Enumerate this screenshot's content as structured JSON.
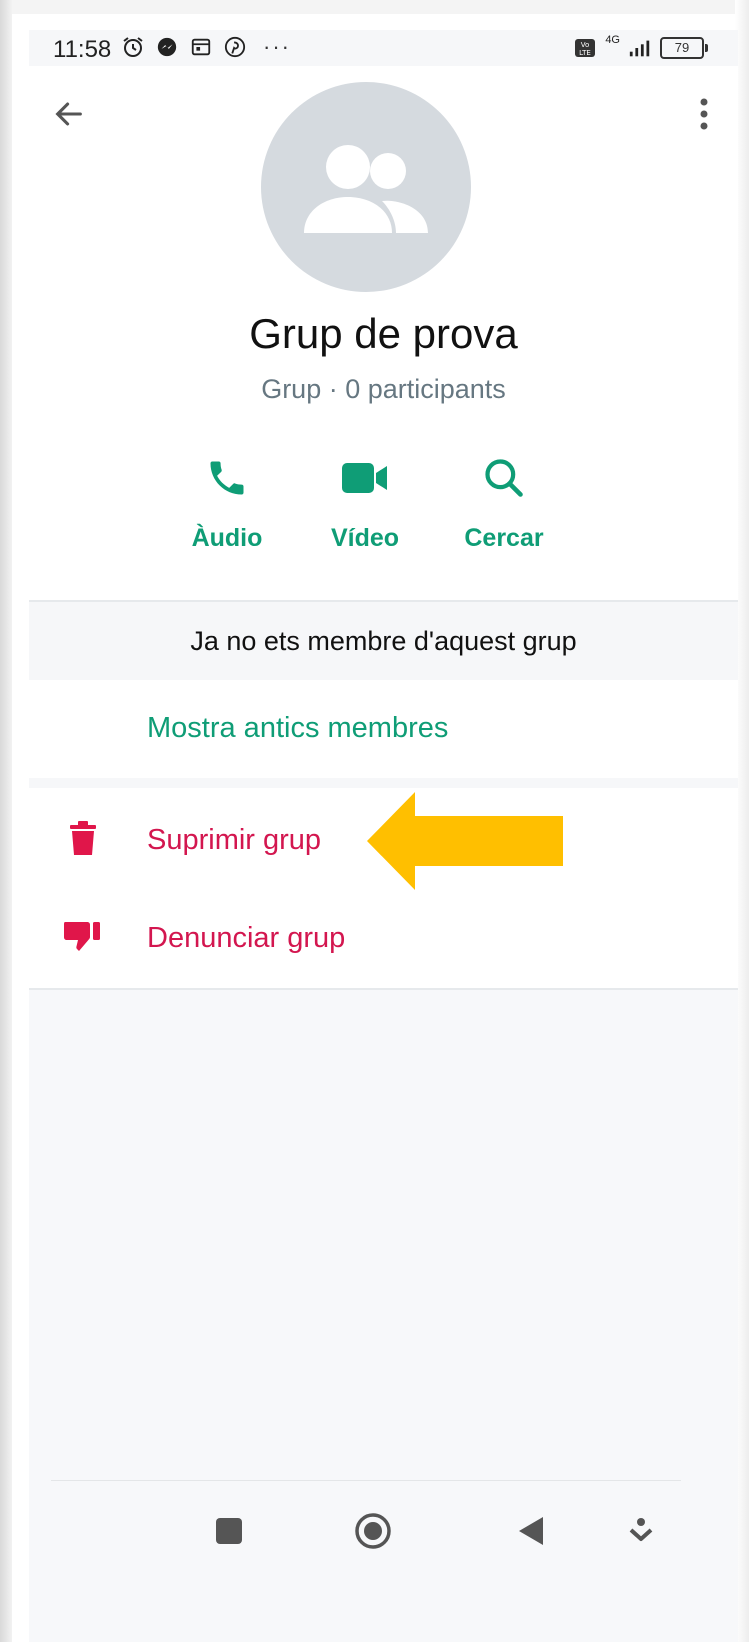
{
  "status_bar": {
    "time": "11:58",
    "more_notifications": "···",
    "network": "4G",
    "battery_level": "79"
  },
  "header": {
    "group_name": "Grup de prova",
    "group_subtitle": "Grup · 0 participants"
  },
  "actions": [
    {
      "label": "Àudio",
      "icon": "phone-icon"
    },
    {
      "label": "Vídeo",
      "icon": "video-camera-icon"
    },
    {
      "label": "Cercar",
      "icon": "search-icon"
    }
  ],
  "notice": {
    "text": "Ja no ets membre d'aquest grup"
  },
  "show_former_members": {
    "label": "Mostra antics membres"
  },
  "danger_actions": [
    {
      "label": "Suprimir grup",
      "icon": "trash-icon"
    },
    {
      "label": "Denunciar grup",
      "icon": "thumbs-down-icon"
    }
  ],
  "colors": {
    "accent": "#0f9d76",
    "danger": "#d3164f",
    "danger_icon": "#e0164a",
    "annotation_arrow": "#ffbf00",
    "avatar_bg": "#d5dadf",
    "subtitle": "#667781",
    "band_bg": "#f6f7f9"
  }
}
